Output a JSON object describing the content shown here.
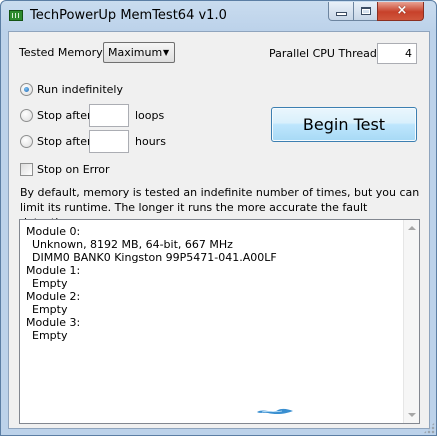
{
  "window": {
    "title": "TechPowerUp MemTest64 v1.0",
    "close_glyph": "×"
  },
  "settings": {
    "tested_memory_label": "Tested Memory:",
    "tested_memory_value": "Maximum",
    "parallel_threads_label": "Parallel CPU Threads:",
    "parallel_threads_value": "4",
    "run_indefinitely_label": "Run indefinitely",
    "stop_after_loops_label": "Stop after",
    "loops_unit": "loops",
    "stop_after_hours_label": "Stop after",
    "hours_unit": "hours",
    "stop_on_error_label": "Stop on Error",
    "begin_test_label": "Begin Test",
    "description": "By default, memory is tested an indefinite number of times, but you can limit its runtime. The longer it runs the more accurate the fault detection."
  },
  "modules": [
    {
      "header": "Module 0:",
      "lines": [
        "Unknown, 8192 MB, 64-bit, 667 MHz",
        "DIMM0 BANK0 Kingston 99P5471-041.A00LF"
      ]
    },
    {
      "header": "Module 1:",
      "lines": [
        "Empty"
      ]
    },
    {
      "header": "Module 2:",
      "lines": [
        "Empty"
      ]
    },
    {
      "header": "Module 3:",
      "lines": [
        "Empty"
      ]
    }
  ],
  "colors": {
    "accent": "#3c7fb1",
    "titlebar": "#bcd2ea",
    "close": "#c7412a"
  }
}
